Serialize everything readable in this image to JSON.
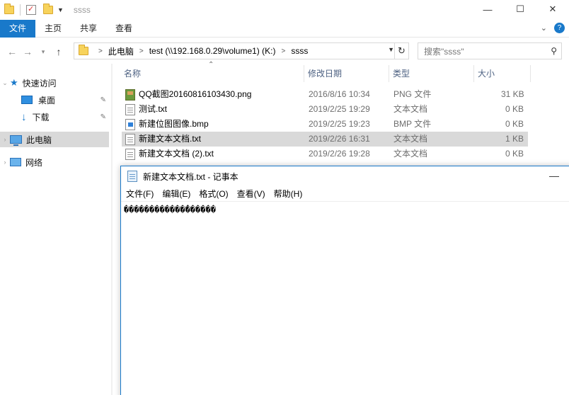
{
  "window": {
    "title": "ssss",
    "controls": {
      "minimize": "—",
      "maximize": "☐",
      "close": "✕"
    }
  },
  "ribbon": {
    "tabs": [
      "文件",
      "主页",
      "共享",
      "查看"
    ],
    "expand_icon": "chevron-down-icon",
    "help_icon": "help-icon"
  },
  "address": {
    "breadcrumbs": [
      "此电脑",
      "test (\\\\192.168.0.29\\volume1) (K:)",
      "ssss"
    ],
    "search_placeholder": "搜索\"ssss\""
  },
  "nav": {
    "items": [
      {
        "label": "快速访问",
        "icon": "star-icon"
      },
      {
        "label": "桌面",
        "icon": "desktop-icon",
        "pinned": true
      },
      {
        "label": "下载",
        "icon": "download-icon",
        "pinned": true
      },
      {
        "label": "此电脑",
        "icon": "computer-icon",
        "selected": true
      },
      {
        "label": "网络",
        "icon": "network-icon"
      }
    ]
  },
  "files": {
    "columns": [
      "名称",
      "修改日期",
      "类型",
      "大小"
    ],
    "rows": [
      {
        "name": "QQ截图20160816103430.png",
        "date": "2016/8/16 10:34",
        "type": "PNG 文件",
        "size": "31 KB",
        "icon": "png-icon"
      },
      {
        "name": "测试.txt",
        "date": "2019/2/25 19:29",
        "type": "文本文档",
        "size": "0 KB",
        "icon": "txt-icon"
      },
      {
        "name": "新建位图图像.bmp",
        "date": "2019/2/25 19:23",
        "type": "BMP 文件",
        "size": "0 KB",
        "icon": "bmp-icon"
      },
      {
        "name": "新建文本文档.txt",
        "date": "2019/2/26 16:31",
        "type": "文本文档",
        "size": "1 KB",
        "icon": "txt-icon",
        "selected": true
      },
      {
        "name": "新建文本文档 (2).txt",
        "date": "2019/2/26 19:28",
        "type": "文本文档",
        "size": "0 KB",
        "icon": "txt-icon"
      }
    ]
  },
  "notepad": {
    "title": "新建文本文档.txt - 记事本",
    "menu": [
      "文件(F)",
      "编辑(E)",
      "格式(O)",
      "查看(V)",
      "帮助(H)"
    ],
    "content": "������������̓������"
  }
}
